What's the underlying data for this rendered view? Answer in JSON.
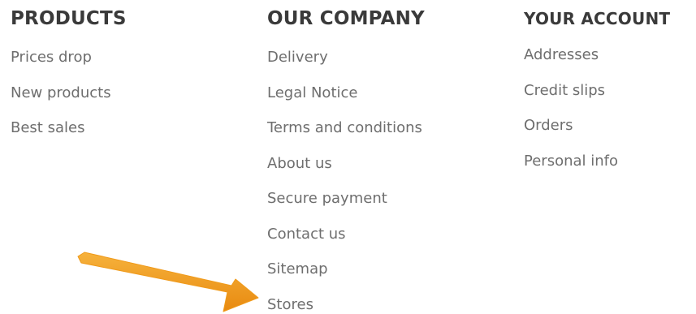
{
  "footer": {
    "products": {
      "title": "PRODUCTS",
      "links": [
        "Prices drop",
        "New products",
        "Best sales"
      ]
    },
    "company": {
      "title": "OUR COMPANY",
      "links": [
        "Delivery",
        "Legal Notice",
        "Terms and conditions",
        "About us",
        "Secure payment",
        "Contact us",
        "Sitemap",
        "Stores"
      ]
    },
    "account": {
      "title": "YOUR ACCOUNT",
      "links": [
        "Addresses",
        "Credit slips",
        "Orders",
        "Personal info"
      ]
    }
  },
  "annotation": {
    "arrow_color": "#f09a1a",
    "target": "Stores"
  }
}
